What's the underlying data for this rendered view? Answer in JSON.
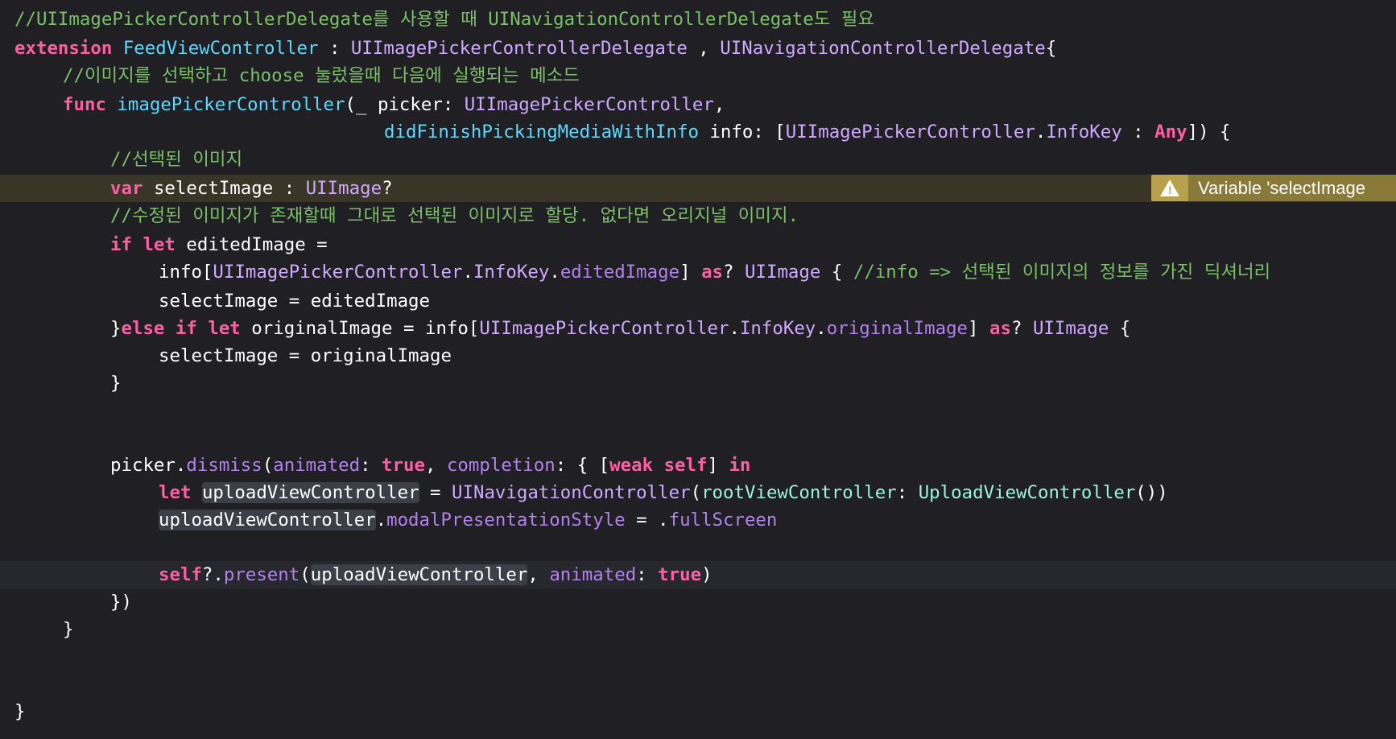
{
  "colors": {
    "background": "#1f1f24",
    "keyword": "#fc5fa3",
    "comment": "#7bbf66",
    "type": "#d0a8ff",
    "type_decl": "#5dd8ff",
    "warning_banner": "#8a7a3a"
  },
  "warning": {
    "icon": "warning-triangle-icon",
    "message": "Variable 'selectImage"
  },
  "lines": {
    "l01": {
      "comment": "//UIImagePickerControllerDelegate를 사용할 때 UINavigationControllerDelegate도 필요"
    },
    "l02": {
      "kw": "extension",
      "name": "FeedViewController",
      "p1": " : ",
      "t1": "UIImagePickerControllerDelegate",
      "p2": " , ",
      "t2": "UINavigationControllerDelegate",
      "p3": "{"
    },
    "l03": {
      "comment": "//이미지를 선택하고 choose 눌렀을때 다음에 실행되는 메소드"
    },
    "l04": {
      "kw": "func",
      "name": "imagePickerController",
      "p1": "(_ picker: ",
      "t1": "UIImagePickerController",
      "p2": ","
    },
    "l05": {
      "label": "didFinishPickingMediaWithInfo",
      "p1": " info: [",
      "t1": "UIImagePickerController",
      "p2": ".",
      "t2": "InfoKey",
      "p3": " : ",
      "kw": "Any",
      "p4": "]) {"
    },
    "l06": {
      "comment": "//선택된 이미지"
    },
    "l07": {
      "kw": "var",
      "name": "selectImage",
      "p1": " : ",
      "t1": "UIImage",
      "p2": "?"
    },
    "l08": {
      "comment": "//수정된 이미지가 존재할때 그대로 선택된 이미지로 할당. 없다면 오리지널 이미지."
    },
    "l09": {
      "kw1": "if",
      "kw2": "let",
      "p1": " editedImage ="
    },
    "l10": {
      "p1": "info[",
      "t1": "UIImagePickerController",
      "p2": ".",
      "t2": "InfoKey",
      "p3": ".",
      "prop": "editedImage",
      "p4": "] ",
      "kw": "as",
      "p5": "? ",
      "t3": "UIImage",
      "p6": " { ",
      "comment": "//info => 선택된 이미지의 정보를 가진 딕셔너리"
    },
    "l11": {
      "p1": "selectImage = editedImage"
    },
    "l12": {
      "p1": "}",
      "kw1": "else",
      "kw2": "if",
      "kw3": "let",
      "p2": " originalImage = info[",
      "t1": "UIImagePickerController",
      "p3": ".",
      "t2": "InfoKey",
      "p4": ".",
      "prop": "originalImage",
      "p5": "] ",
      "kw4": "as",
      "p6": "? ",
      "t3": "UIImage",
      "p7": " {"
    },
    "l13": {
      "p1": "selectImage = originalImage"
    },
    "l14": {
      "p1": "}"
    },
    "l15": {
      "p1": "picker.",
      "m1": "dismiss",
      "p2": "(",
      "a1": "animated",
      "p3": ": ",
      "kw1": "true",
      "p4": ", ",
      "a2": "completion",
      "p5": ": { [",
      "kw2": "weak",
      "kw3": "self",
      "p6": "] ",
      "kw4": "in"
    },
    "l16": {
      "kw": "let",
      "var": "uploadViewController",
      "p1": " = ",
      "t1": "UINavigationController",
      "p2": "(",
      "a1": "rootViewController",
      "p3": ": ",
      "c1": "UploadViewController",
      "p4": "())"
    },
    "l17": {
      "var": "uploadViewController",
      "p1": ".",
      "prop1": "modalPresentationStyle",
      "p2": " = .",
      "prop2": "fullScreen"
    },
    "l18": {
      "kw1": "self",
      "p1": "?.",
      "m1": "present",
      "p2": "(",
      "var": "uploadViewController",
      "p3": ", ",
      "a1": "animated",
      "p4": ": ",
      "kw2": "true",
      "p5": ")"
    },
    "l19": {
      "p1": "})"
    },
    "l20": {
      "p1": "}"
    },
    "l21": {
      "p1": "}"
    }
  }
}
